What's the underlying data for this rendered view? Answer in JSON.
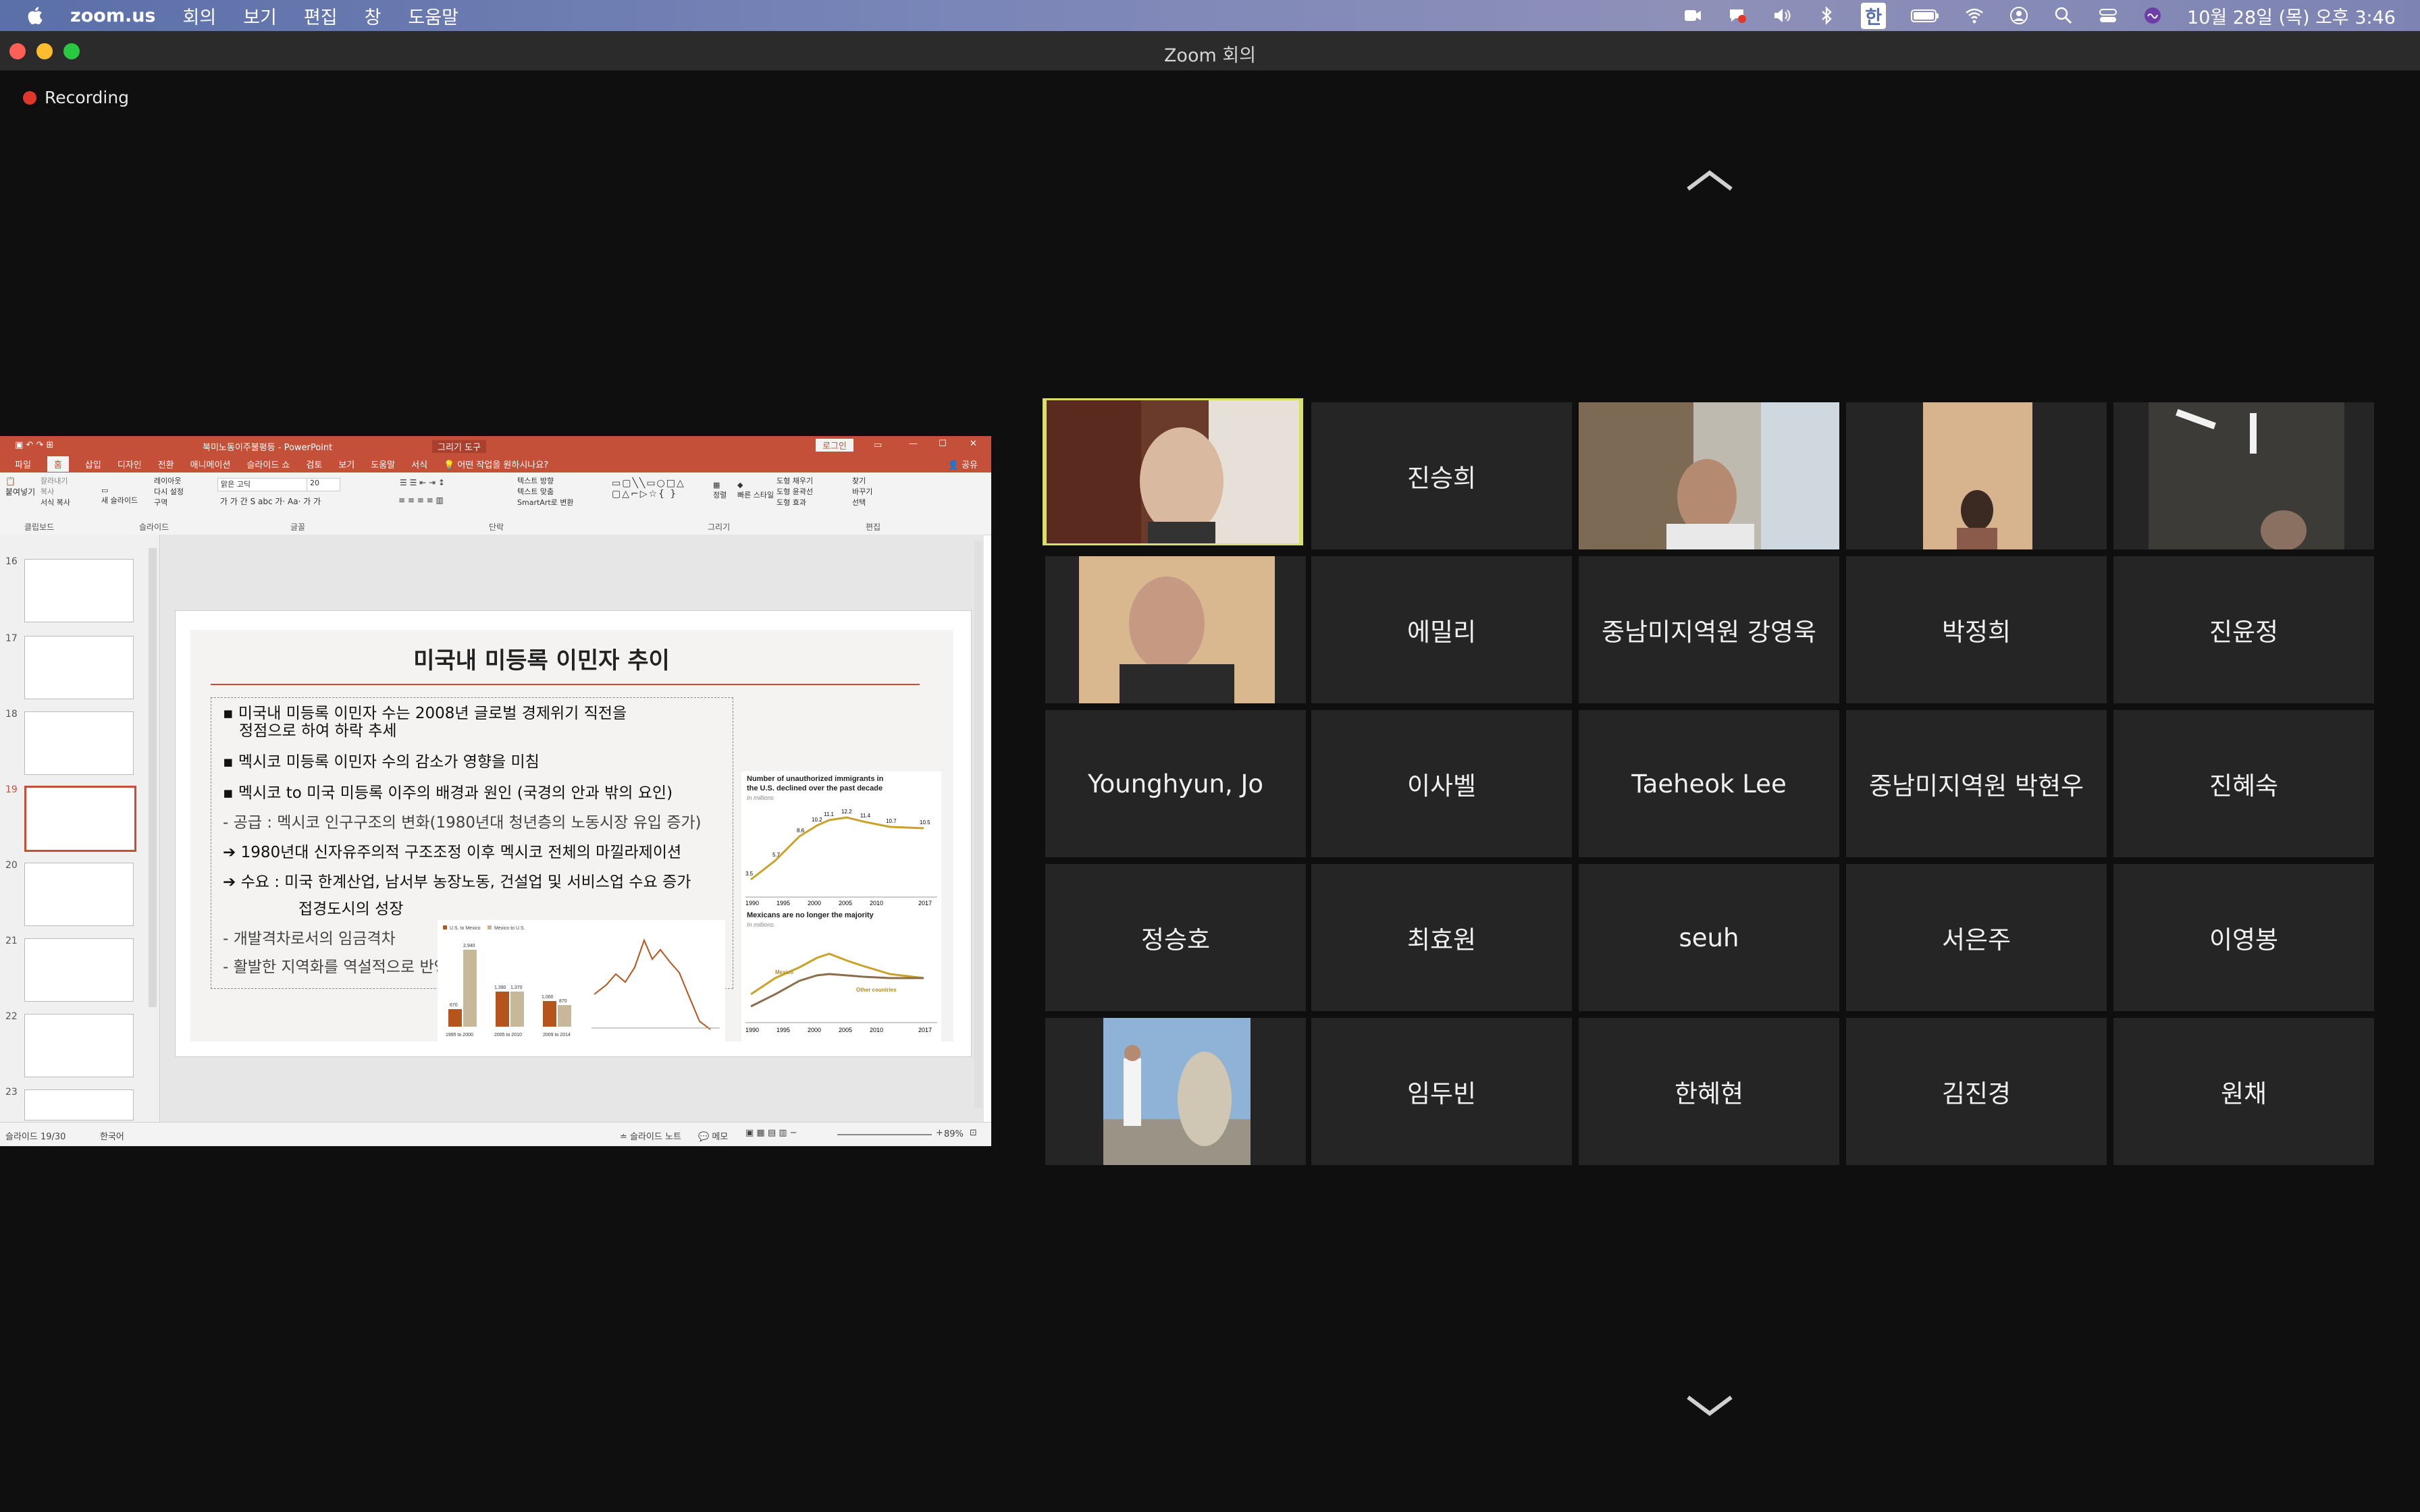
{
  "menubar": {
    "app_name": "zoom.us",
    "menus": [
      "회의",
      "보기",
      "편집",
      "창",
      "도움말"
    ],
    "ime_label": "한",
    "clock": "10월 28일 (목) 오후 3:46"
  },
  "window": {
    "title": "Zoom 회의"
  },
  "recording": {
    "label": "Recording"
  },
  "powerpoint": {
    "title": "북미노동이주불평등 - PowerPoint",
    "context_tab": "그리기 도구",
    "login": "로그인",
    "tabs": [
      "파일",
      "홈",
      "삽입",
      "디자인",
      "전환",
      "애니메이션",
      "슬라이드 쇼",
      "검토",
      "보기",
      "도움말",
      "서식"
    ],
    "selected_tab": "홈",
    "tell_me": "어떤 작업을 원하시나요?",
    "share": "공유",
    "ribbon_groups": [
      "클립보드",
      "슬라이드",
      "글꼴",
      "단락",
      "그리기",
      "편집"
    ],
    "ribbon_items": {
      "paste": "붙여넣기",
      "cut": "잘라내기",
      "copy": "복사",
      "format_painter": "서식 복사",
      "new_slide": "새 슬라이드",
      "layout": "레이아웃",
      "reset": "다시 설정",
      "section": "구역",
      "font_name": "맑은 고딕",
      "font_size": "20",
      "arrange": "정렬",
      "quick_styles": "빠른 스타일",
      "shape_fill": "도형 채우기",
      "shape_outline": "도형 윤곽선",
      "shape_effects": "도형 효과",
      "find": "찾기",
      "replace": "바꾸기",
      "select": "선택",
      "text_direction": "텍스트 방향",
      "align_text": "텍스트 맞춤",
      "smartart": "SmartArt로 변환"
    },
    "thumbnail_numbers": [
      "16",
      "17",
      "18",
      "19",
      "20",
      "21",
      "22",
      "23"
    ],
    "selected_slide": "19",
    "slide": {
      "title": "미국내 미등록 이민자 추이",
      "lines": [
        "▪ 미국내 미등록 이민자 수는 2008년 글로벌 경제위기 직전을",
        "정점으로 하여 하락 추세",
        "▪ 멕시코 미등록 이민자 수의 감소가 영향을 미침",
        "▪ 멕시코 to 미국 미등록 이주의 배경과 원인 (국경의 안과 밖의 요인)",
        "- 공급 : 멕시코 인구구조의 변화(1980년대 청년층의 노동시장 유입 증가)",
        "➔ 1980년대 신자유주의적 구조조정 이후 멕시코 전체의 마낄라제이션",
        "➔ 수요 : 미국 한계산업, 남서부 농장노동, 건설업 및 서비스업 수요 증가",
        "접경도시의 성장",
        "- 개발격차로서의 임금격차",
        "- 활발한 지역화를 역설적으로 반영"
      ],
      "chart_top_title": "Number of unauthorized immigrants in the U.S. declined over the past decade",
      "chart_top_unit": "In millions",
      "chart_top_labels": [
        "3.5",
        "5.7",
        "8.6",
        "10.2",
        "11.1",
        "12.2",
        "11.4",
        "10.7",
        "10.5"
      ],
      "chart_top_years": [
        "1990",
        "1995",
        "2000",
        "2005",
        "2010",
        "2017"
      ],
      "chart_bottom_title": "Mexicans are no longer the majority",
      "chart_bottom_unit": "In millions",
      "chart_bottom_mexico": "Mexico",
      "chart_bottom_other": "Other countries",
      "bar_legend": [
        "U.S. to Mexico",
        "Mexico to U.S."
      ],
      "bar_values": [
        "670",
        "2,940",
        "1,390",
        "1,370",
        "1,000",
        "870"
      ],
      "bar_periods": [
        "1995 to 2000",
        "2005 to 2010",
        "2009 to 2014"
      ]
    },
    "status": {
      "slide_count": "슬라이드 19/30",
      "language": "한국어",
      "notes": "슬라이드 노트",
      "comments": "메모",
      "zoom": "89%"
    }
  },
  "gallery": {
    "participants": [
      {
        "name": "",
        "video": true
      },
      {
        "name": "진승희"
      },
      {
        "name": "",
        "video": true
      },
      {
        "name": "",
        "video": true
      },
      {
        "name": "",
        "video": true
      },
      {
        "name": "",
        "video": true
      },
      {
        "name": "에밀리"
      },
      {
        "name": "중남미지역원 강영욱"
      },
      {
        "name": "박정희"
      },
      {
        "name": "진윤정"
      },
      {
        "name": "Younghyun, Jo"
      },
      {
        "name": "이사벨"
      },
      {
        "name": "Taeheok Lee"
      },
      {
        "name": "중남미지역원 박현우"
      },
      {
        "name": "진혜숙"
      },
      {
        "name": "정승호"
      },
      {
        "name": "최효원"
      },
      {
        "name": "seuh"
      },
      {
        "name": "서은주"
      },
      {
        "name": "이영봉"
      },
      {
        "name": "",
        "video": true
      },
      {
        "name": "임두빈"
      },
      {
        "name": "한혜현"
      },
      {
        "name": "김진경"
      },
      {
        "name": "원채"
      }
    ]
  }
}
